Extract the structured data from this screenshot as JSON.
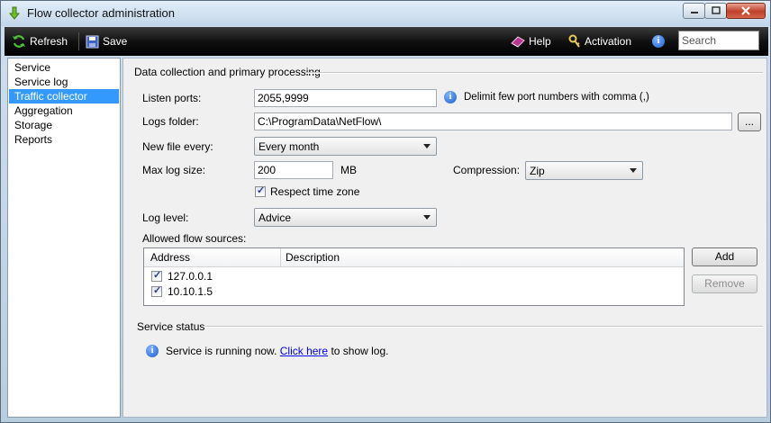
{
  "window": {
    "title": "Flow collector administration"
  },
  "toolbar": {
    "refresh_label": "Refresh",
    "save_label": "Save",
    "help_label": "Help",
    "activation_label": "Activation",
    "search_value": "Search"
  },
  "sidebar": {
    "items": [
      {
        "label": "Service"
      },
      {
        "label": "Service log"
      },
      {
        "label": "Traffic collector"
      },
      {
        "label": "Aggregation"
      },
      {
        "label": "Storage"
      },
      {
        "label": "Reports"
      }
    ],
    "selected": "Traffic collector"
  },
  "form": {
    "section_title": "Data collection and primary processing",
    "listen_ports_label": "Listen ports:",
    "listen_ports_value": "2055,9999",
    "listen_ports_hint": "Delimit few port numbers with comma (,)",
    "logs_folder_label": "Logs folder:",
    "logs_folder_value": "C:\\ProgramData\\NetFlow\\",
    "browse_label": "...",
    "new_file_label": "New file every:",
    "new_file_value": "Every month",
    "max_log_label": "Max log size:",
    "max_log_value": "200",
    "max_log_unit": "MB",
    "compression_label": "Compression:",
    "compression_value": "Zip",
    "respect_tz_label": "Respect time zone",
    "respect_tz_checked": true,
    "log_level_label": "Log level:",
    "log_level_value": "Advice",
    "allowed_sources_label": "Allowed flow sources:",
    "columns": [
      "Address",
      "Description"
    ],
    "sources": [
      {
        "address": "127.0.0.1",
        "description": "",
        "checked": true
      },
      {
        "address": "10.10.1.5",
        "description": "",
        "checked": true
      }
    ],
    "add_label": "Add",
    "remove_label": "Remove"
  },
  "status": {
    "section_title": "Service status",
    "text_before": "Service is running now.",
    "link_text": "Click here",
    "text_after": "to show log."
  },
  "colors": {
    "selection": "#3399ff",
    "toolbar": "#000000",
    "link": "#0000ee"
  }
}
